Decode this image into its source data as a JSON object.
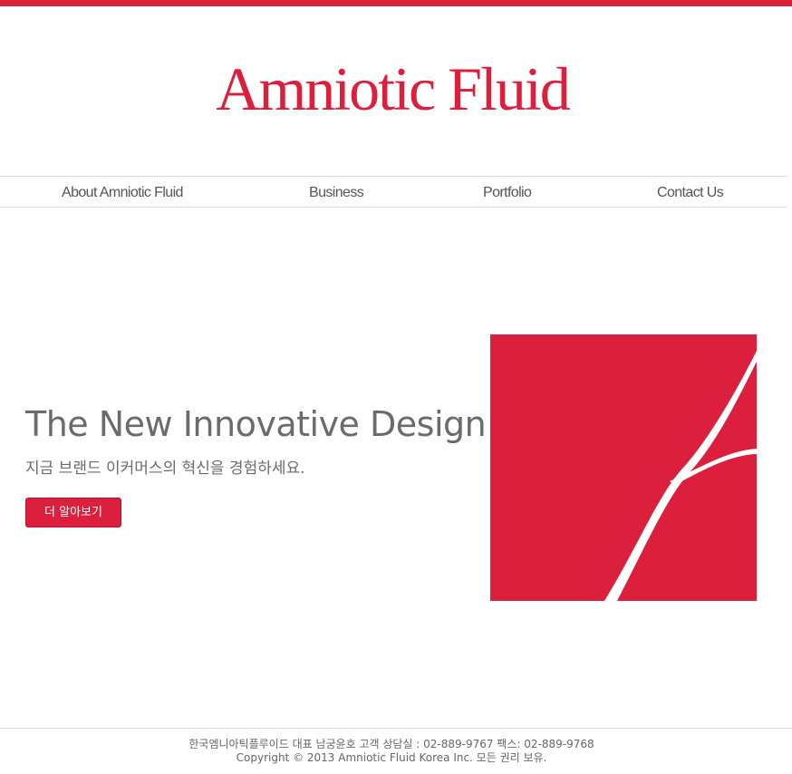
{
  "brand": {
    "logo_text": "Amniotic Fluid",
    "accent_color": "#dc1f3c"
  },
  "nav": {
    "items": [
      {
        "label": "About Amniotic Fluid"
      },
      {
        "label": "Business"
      },
      {
        "label": "Portfolio"
      },
      {
        "label": "Contact Us"
      }
    ]
  },
  "hero": {
    "title": "The New Innovative Design",
    "subtitle": "지금 브랜드 이커머스의 혁신을 경험하세요.",
    "cta_label": "더 알아보기",
    "graphic_icon": "red-square-brand-mark"
  },
  "footer": {
    "company_line": "한국엠니아틱플루이드 대표 남궁윤호 고객 상담실 : 02-889-9767 팩스: 02-889-9768",
    "copyright_line": "Copyright © 2013 Amniotic Fluid Korea Inc. 모든 권리 보유."
  }
}
